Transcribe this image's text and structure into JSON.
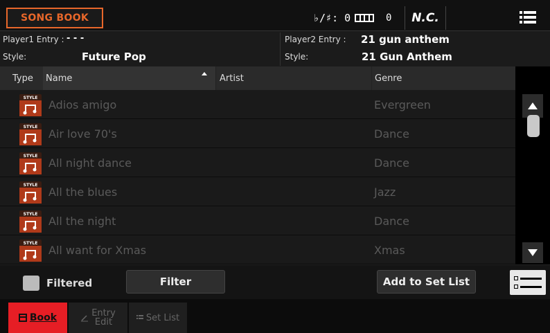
{
  "header": {
    "title": "SONG BOOK",
    "transpose": "♭/♯: 0",
    "keyboard_value": "0",
    "chord": "N.C."
  },
  "entry_info": {
    "player1_label": "Player1 Entry :",
    "player1_value": "- - -",
    "style1_label": "Style:",
    "style1_value": "Future Pop",
    "player2_label": "Player2 Entry :",
    "player2_value": "21 gun anthem",
    "style2_label": "Style:",
    "style2_value": "21 Gun Anthem"
  },
  "table": {
    "columns": [
      "Type",
      "Name",
      "Artist",
      "Genre"
    ],
    "type_icon_label": "STYLE",
    "rows": [
      {
        "name": "Adios amigo",
        "artist": "",
        "genre": "Evergreen"
      },
      {
        "name": "Air love 70's",
        "artist": "",
        "genre": "Dance"
      },
      {
        "name": "All night dance",
        "artist": "",
        "genre": "Dance"
      },
      {
        "name": "All the blues",
        "artist": "",
        "genre": "Jazz"
      },
      {
        "name": "All the night",
        "artist": "",
        "genre": "Dance"
      },
      {
        "name": "All want for Xmas",
        "artist": "",
        "genre": "Xmas"
      }
    ]
  },
  "toolbar": {
    "filtered_label": "Filtered",
    "filter_label": "Filter",
    "add_label": "Add to Set List"
  },
  "tabs": {
    "book": "Book",
    "entry_line1": "Entry",
    "entry_line2": "Edit",
    "setlist": "Set List"
  },
  "colors": {
    "accent": "#e8672a",
    "active_tab": "#e61e25",
    "row_text": "#5a5a5a"
  }
}
